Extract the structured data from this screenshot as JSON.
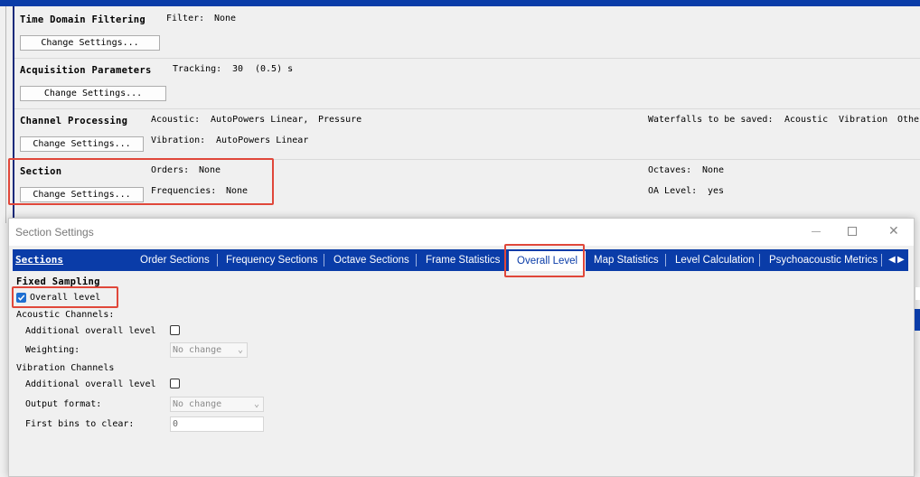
{
  "sections": {
    "time_domain": {
      "title": "Time Domain Filtering",
      "button": "Change Settings...",
      "filter_label": "Filter:",
      "filter_value": "None"
    },
    "acquisition": {
      "title": "Acquisition Parameters",
      "button": "Change Settings...",
      "tracking_label": "Tracking:",
      "tracking_value": "30",
      "tracking_extra": "(0.5) s"
    },
    "channel": {
      "title": "Channel Processing",
      "button": "Change Settings...",
      "acoustic_label": "Acoustic:",
      "acoustic_value": "AutoPowers Linear,",
      "acoustic_value2": "Pressure",
      "vibration_label": "Vibration:",
      "vibration_value": "AutoPowers Linear",
      "waterfalls_label": "Waterfalls to be saved:",
      "wf_acoustic": "Acoustic",
      "wf_vibration": "Vibration",
      "wf_other": "Othe"
    },
    "section": {
      "title": "Section",
      "button": "Change Settings...",
      "orders_label": "Orders:",
      "orders_value": "None",
      "frequencies_label": "Frequencies:",
      "frequencies_value": "None",
      "octaves_label": "Octaves:",
      "octaves_value": "None",
      "oa_label": "OA Level:",
      "oa_value": "yes"
    }
  },
  "dialog": {
    "title": "Section Settings",
    "tabs": [
      "Sections",
      "Order Sections",
      "Frequency Sections",
      "Octave Sections",
      "Frame Statistics",
      "Overall Level",
      "Map Statistics",
      "Level Calculation",
      "Psychoacoustic Metrics"
    ],
    "active_tab": "Overall Level",
    "group_title": "Fixed Sampling",
    "overall_level_label": "Overall level",
    "overall_level_checked": true,
    "acoustic_channels": "Acoustic Channels:",
    "additional_overall_level": "Additional overall level",
    "weighting_label": "Weighting:",
    "weighting_value": "No change",
    "vibration_channels": "Vibration Channels",
    "additional_overall_level_2": "Additional overall level",
    "output_format_label": "Output format:",
    "output_format_value": "No change",
    "first_bins_label": "First bins to clear:",
    "first_bins_value": "0"
  }
}
